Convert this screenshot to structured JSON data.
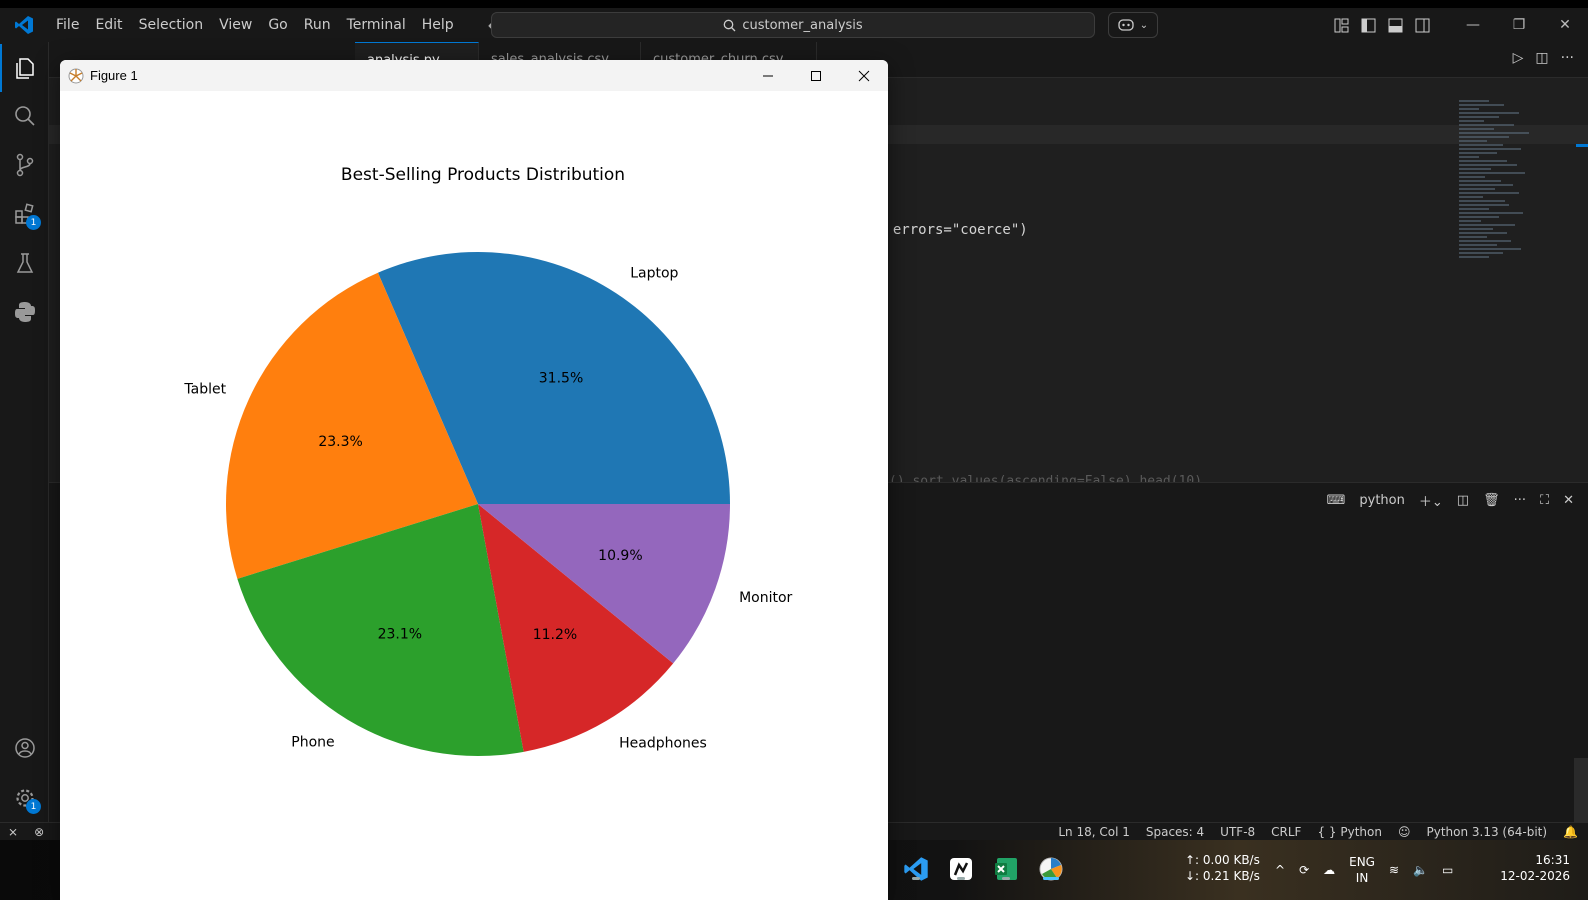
{
  "titlebar": {
    "menu": [
      "File",
      "Edit",
      "Selection",
      "View",
      "Go",
      "Run",
      "Terminal",
      "Help"
    ],
    "search": "customer_analysis"
  },
  "editor": {
    "tabs": [
      "analysis.py",
      "sales_analysis.csv",
      "customer_churn.csv"
    ],
    "code_line": ", errors=\"coerce\")",
    "ghost_line": "().sort_values(ascending=False).head(10)"
  },
  "panel": {
    "terminal_name": "python"
  },
  "activity_badges": {
    "extensions": "1",
    "settings": "1"
  },
  "statusbar": {
    "position": "Ln 18, Col 1",
    "spaces": "Spaces: 4",
    "encoding": "UTF-8",
    "eol": "CRLF",
    "language": "{ } Python",
    "interpreter": "Python 3.13 (64-bit)"
  },
  "taskbar": {
    "net_up": "↑: 0.00 KB/s",
    "net_down": "↓: 0.21 KB/s",
    "lang_top": "ENG",
    "lang_bottom": "IN",
    "time": "16:31",
    "date": "12-02-2026"
  },
  "figure": {
    "window_title": "Figure 1"
  },
  "chart_data": {
    "type": "pie",
    "title": "Best-Selling Products Distribution",
    "labels": [
      "Laptop",
      "Tablet",
      "Phone",
      "Headphones",
      "Monitor"
    ],
    "values": [
      31.5,
      23.3,
      23.1,
      11.2,
      10.9
    ],
    "pct_labels": [
      "31.5%",
      "23.3%",
      "23.1%",
      "11.2%",
      "10.9%"
    ],
    "colors": [
      "#1f77b4",
      "#ff7f0e",
      "#2ca02c",
      "#d62728",
      "#9467bd"
    ],
    "start_angle": 0,
    "direction": "counterclockwise"
  },
  "colors": {
    "accent": "#0078d4",
    "editor_bg": "#1f1f1f",
    "chrome_bg": "#181818"
  }
}
